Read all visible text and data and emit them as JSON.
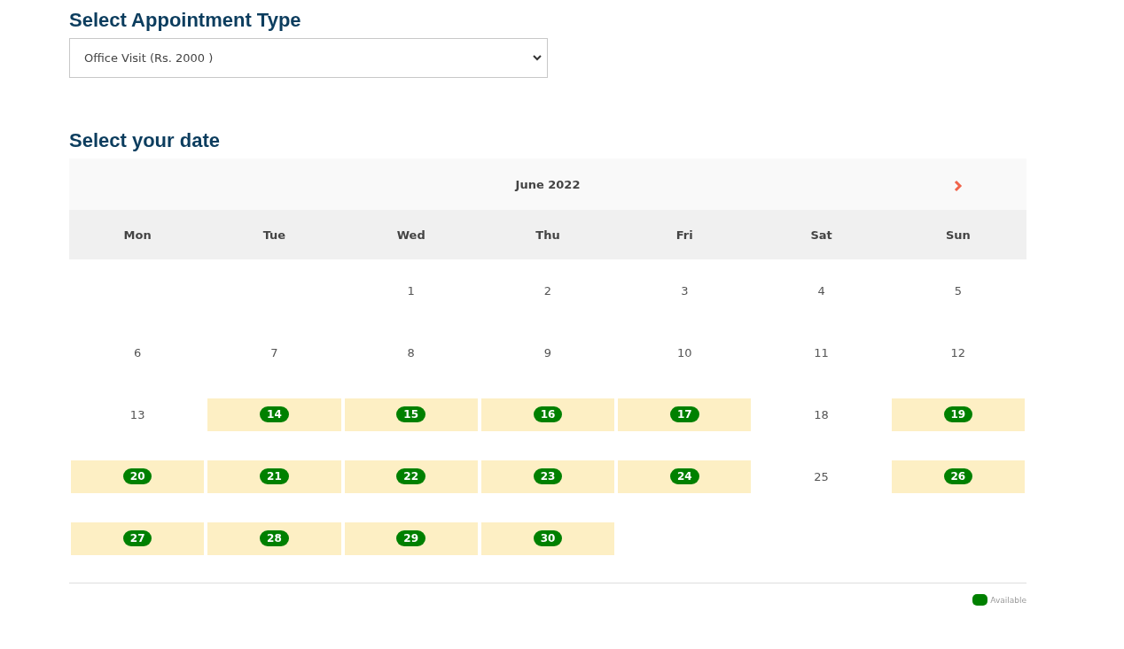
{
  "appointment_heading": "Select Appointment Type",
  "appointment_type": {
    "value": "Office Visit (Rs. 2000 )"
  },
  "date_heading": "Select your date",
  "calendar": {
    "month": "June 2022",
    "weekdays": [
      "Mon",
      "Tue",
      "Wed",
      "Thu",
      "Fri",
      "Sat",
      "Sun"
    ],
    "weeks": [
      [
        {
          "kind": "blank"
        },
        {
          "kind": "blank"
        },
        {
          "kind": "day",
          "day": "1",
          "available": false
        },
        {
          "kind": "day",
          "day": "2",
          "available": false
        },
        {
          "kind": "day",
          "day": "3",
          "available": false
        },
        {
          "kind": "day",
          "day": "4",
          "available": false
        },
        {
          "kind": "day",
          "day": "5",
          "available": false
        }
      ],
      [
        {
          "kind": "day",
          "day": "6",
          "available": false
        },
        {
          "kind": "day",
          "day": "7",
          "available": false
        },
        {
          "kind": "day",
          "day": "8",
          "available": false
        },
        {
          "kind": "day",
          "day": "9",
          "available": false
        },
        {
          "kind": "day",
          "day": "10",
          "available": false
        },
        {
          "kind": "day",
          "day": "11",
          "available": false
        },
        {
          "kind": "day",
          "day": "12",
          "available": false
        }
      ],
      [
        {
          "kind": "day",
          "day": "13",
          "available": false
        },
        {
          "kind": "day",
          "day": "14",
          "available": true
        },
        {
          "kind": "day",
          "day": "15",
          "available": true
        },
        {
          "kind": "day",
          "day": "16",
          "available": true
        },
        {
          "kind": "day",
          "day": "17",
          "available": true
        },
        {
          "kind": "day",
          "day": "18",
          "available": false
        },
        {
          "kind": "day",
          "day": "19",
          "available": true
        }
      ],
      [
        {
          "kind": "day",
          "day": "20",
          "available": true
        },
        {
          "kind": "day",
          "day": "21",
          "available": true
        },
        {
          "kind": "day",
          "day": "22",
          "available": true
        },
        {
          "kind": "day",
          "day": "23",
          "available": true
        },
        {
          "kind": "day",
          "day": "24",
          "available": true
        },
        {
          "kind": "day",
          "day": "25",
          "available": false
        },
        {
          "kind": "day",
          "day": "26",
          "available": true
        }
      ],
      [
        {
          "kind": "day",
          "day": "27",
          "available": true
        },
        {
          "kind": "day",
          "day": "28",
          "available": true
        },
        {
          "kind": "day",
          "day": "29",
          "available": true
        },
        {
          "kind": "day",
          "day": "30",
          "available": true
        },
        {
          "kind": "blank"
        },
        {
          "kind": "blank"
        },
        {
          "kind": "blank"
        }
      ]
    ]
  },
  "legend": [
    {
      "label": "Available",
      "color": "#008000"
    }
  ]
}
